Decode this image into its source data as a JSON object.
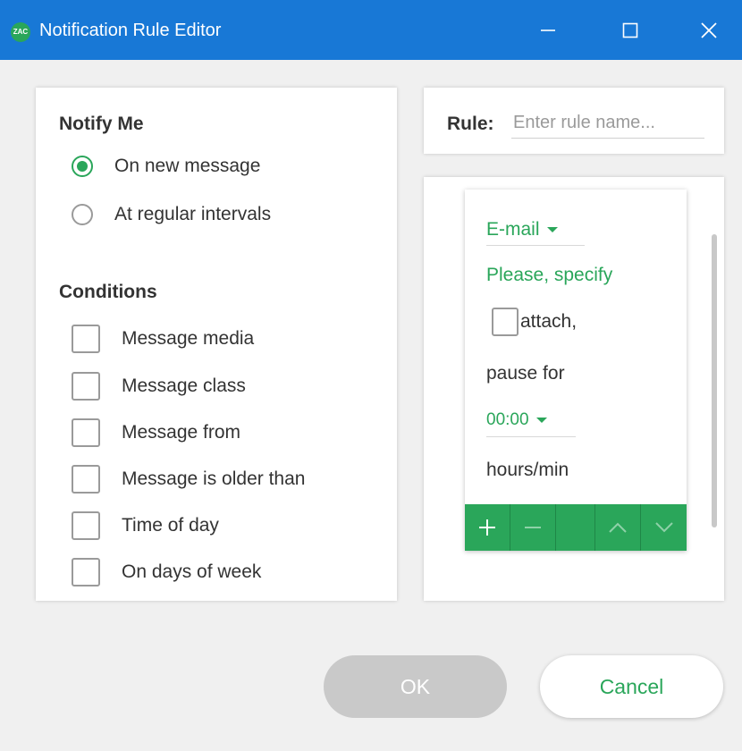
{
  "window": {
    "title": "Notification Rule Editor",
    "app_icon_text": "ZAC",
    "titlebar_color": "#1878d6"
  },
  "notify": {
    "heading": "Notify Me",
    "options": [
      {
        "label": "On new message",
        "selected": true
      },
      {
        "label": "At regular intervals",
        "selected": false
      }
    ]
  },
  "conditions": {
    "heading": "Conditions",
    "items": [
      {
        "label": "Message media",
        "checked": false
      },
      {
        "label": "Message class",
        "checked": false
      },
      {
        "label": "Message from",
        "checked": false
      },
      {
        "label": "Message is older than",
        "checked": false
      },
      {
        "label": "Time of day",
        "checked": false
      },
      {
        "label": "On days of week",
        "checked": false
      }
    ]
  },
  "rule": {
    "label": "Rule:",
    "placeholder": "Enter rule name...",
    "value": ""
  },
  "action": {
    "channel": "E-mail",
    "prompt": "Please, specify",
    "attach_label": "attach,",
    "attach_checked": false,
    "pause_label": "pause for",
    "pause_value": "00:00",
    "unit_label": "hours/min",
    "toolbar": [
      "plus-icon",
      "minus-icon",
      "blank",
      "chevron-up-icon",
      "chevron-down-icon"
    ]
  },
  "footer": {
    "ok_label": "OK",
    "cancel_label": "Cancel"
  },
  "colors": {
    "accent": "#2aa65a",
    "disabled": "#c9c9c9"
  }
}
